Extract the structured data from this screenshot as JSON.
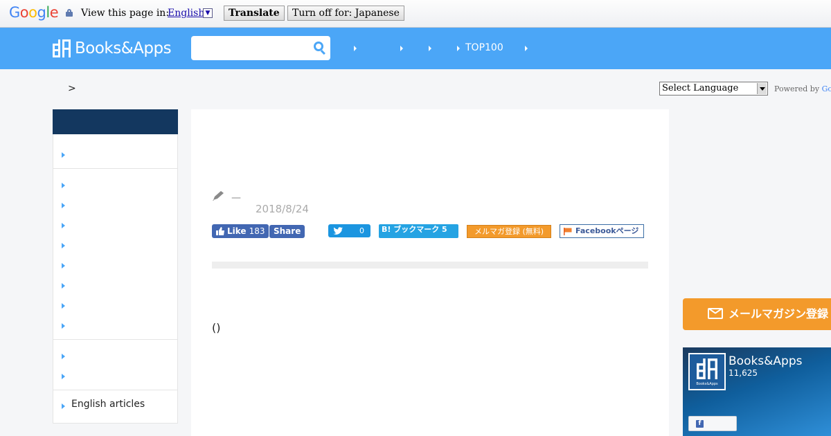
{
  "translate_bar": {
    "logo_text": [
      "G",
      "o",
      "o",
      "g",
      "l",
      "e"
    ],
    "view_label": "View this page in:",
    "language": "English",
    "translate_button": "Translate",
    "turn_off_button": "Turn off for: Japanese"
  },
  "header": {
    "logo_text": "Books&Apps",
    "search_placeholder": "",
    "nav_top": "TOP100"
  },
  "breadcrumb": ">",
  "language_select": {
    "selected": "Select Language",
    "powered_by": "Powered by ",
    "powered_brand": "Go"
  },
  "sidebar": {
    "items": [
      {
        "label": ""
      },
      {
        "label": ""
      },
      {
        "label": ""
      },
      {
        "label": ""
      },
      {
        "label": ""
      },
      {
        "label": ""
      },
      {
        "label": ""
      },
      {
        "label": ""
      },
      {
        "label": ""
      },
      {
        "label": ""
      },
      {
        "label": ""
      },
      {
        "label": "English articles"
      }
    ]
  },
  "article": {
    "author": "—",
    "date": "2018/8/24",
    "like_label": "Like",
    "like_count": "183",
    "share_label": "Share",
    "tweet_count": "0",
    "hatena_label": "B! ブックマーク 5",
    "mail_magazine_label": "メルマガ登録 (無料)",
    "facebook_page_label": "Facebookページ",
    "body_text": "()"
  },
  "right_column": {
    "mail_banner": "メールマガジン登録",
    "fb_page_name": "Books&Apps",
    "fb_followers": "11,625",
    "fb_avatar_caption": "Books&Apps"
  },
  "colors": {
    "header_blue": "#4ba6f7",
    "sidebar_head": "#13375f",
    "facebook": "#4267b2",
    "twitter": "#1b95e0",
    "hatena": "#25a3e3",
    "orange": "#f39a2b"
  }
}
